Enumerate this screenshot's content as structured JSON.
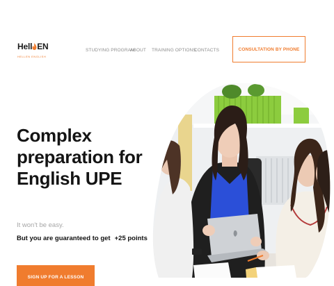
{
  "brand": {
    "name_prefix": "Hell",
    "name_suffix": "EN",
    "tagline": "HELLEN ENGLISH",
    "accent": "#f07c2e"
  },
  "nav": {
    "items": [
      {
        "label": "STUDYING PROGRAM"
      },
      {
        "label": "ABOUT"
      },
      {
        "label": "TRAINING OPTIONS"
      },
      {
        "label": "CONTACTS"
      }
    ],
    "cta_label": "CONSULTATION BY PHONE"
  },
  "hero": {
    "title_lines": [
      "Complex",
      "preparation for",
      "English UPE"
    ],
    "subtitle_muted": "It won't be easy.",
    "subtitle_main": "But you are guaranteed to get",
    "points": "+25 points",
    "cta_label": "SIGN UP FOR A LESSON",
    "image_alt": "students-studying-photo"
  }
}
